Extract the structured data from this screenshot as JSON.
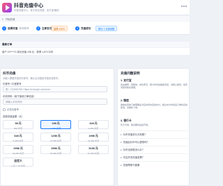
{
  "app": {
    "title": "抖音充值中心",
    "subtitle": "抖音充值中心 · 官方安全充值 · 支付宝/微信"
  },
  "crumb": "1 · 开始充值",
  "steps": [
    {
      "num": "1",
      "label": "选择充值",
      "sub": "填写账号"
    },
    {
      "num": "2",
      "label": "立即支付",
      "sub": ""
    },
    {
      "num": "3",
      "label": "充值成功",
      "sub": ""
    }
  ],
  "badges": {
    "a": "保障 100%",
    "b": "预计 1 分钟到账"
  },
  "notice": {
    "title": "最新订单",
    "text": "用户 19****72 成功充值 198 元，获得 1,970 抖币"
  },
  "recharge": {
    "title": "抖币充值",
    "desc": "请输入需要充值的抖音号，确认后将直接充值到该账号。",
    "account_label": "抖音号 / 抖音账号",
    "account_placeholder": "例：123456789 / https://v.douyin.com/xxxx",
    "phone_label": "手机号码（用于接收订单信息）",
    "phone_placeholder": "请输入手机号码",
    "remember_label": "记住抖音号",
    "amount_label": "选择充值金额（元）",
    "amounts": [
      {
        "coins": "98 元",
        "price": "980 抖币",
        "selected": false
      },
      {
        "coins": "198 元",
        "price": "1,980 抖币",
        "selected": true
      },
      {
        "coins": "328 元",
        "price": "3,280 抖币",
        "selected": false
      },
      {
        "coins": "648 元",
        "price": "6,480 抖币",
        "selected": false
      },
      {
        "coins": "1298 元",
        "price": "12,980 抖币",
        "selected": false
      },
      {
        "coins": "1998 元",
        "price": "19,980 抖币",
        "selected": false
      },
      {
        "coins": "2998 元",
        "price": "29,980 抖币",
        "selected": false
      },
      {
        "coins": "3998 元",
        "price": "39,980 抖币",
        "selected": false
      },
      {
        "coins": "5198 元",
        "price": "51,980 抖币",
        "selected": false
      },
      {
        "coins": "自定义",
        "price": "1 元 = 10 抖币",
        "selected": false
      }
    ]
  },
  "help": {
    "title": "充值问题说明",
    "sections": [
      {
        "h": "1. 支付宝",
        "p": "优先推荐，到账快，成功率高，部分时间会触发风控，请耐心等待，如有问题请联系客服。"
      },
      {
        "h": "2. 微信",
        "p": "微信充值的订单需要在对应时间内完成支付，超过支付时间后订单将自动取消，请重新下单。"
      },
      {
        "h": "3. 银行卡",
        "p": "暂不可用，敬请期待后续开通。"
      }
    ],
    "faqs": [
      "抖币充值多久可到账？",
      "充值后抖币可以提现吗？",
      "抖币没到账怎么办？",
      "可否开具充值发票？",
      "充值帮助与客服"
    ]
  }
}
